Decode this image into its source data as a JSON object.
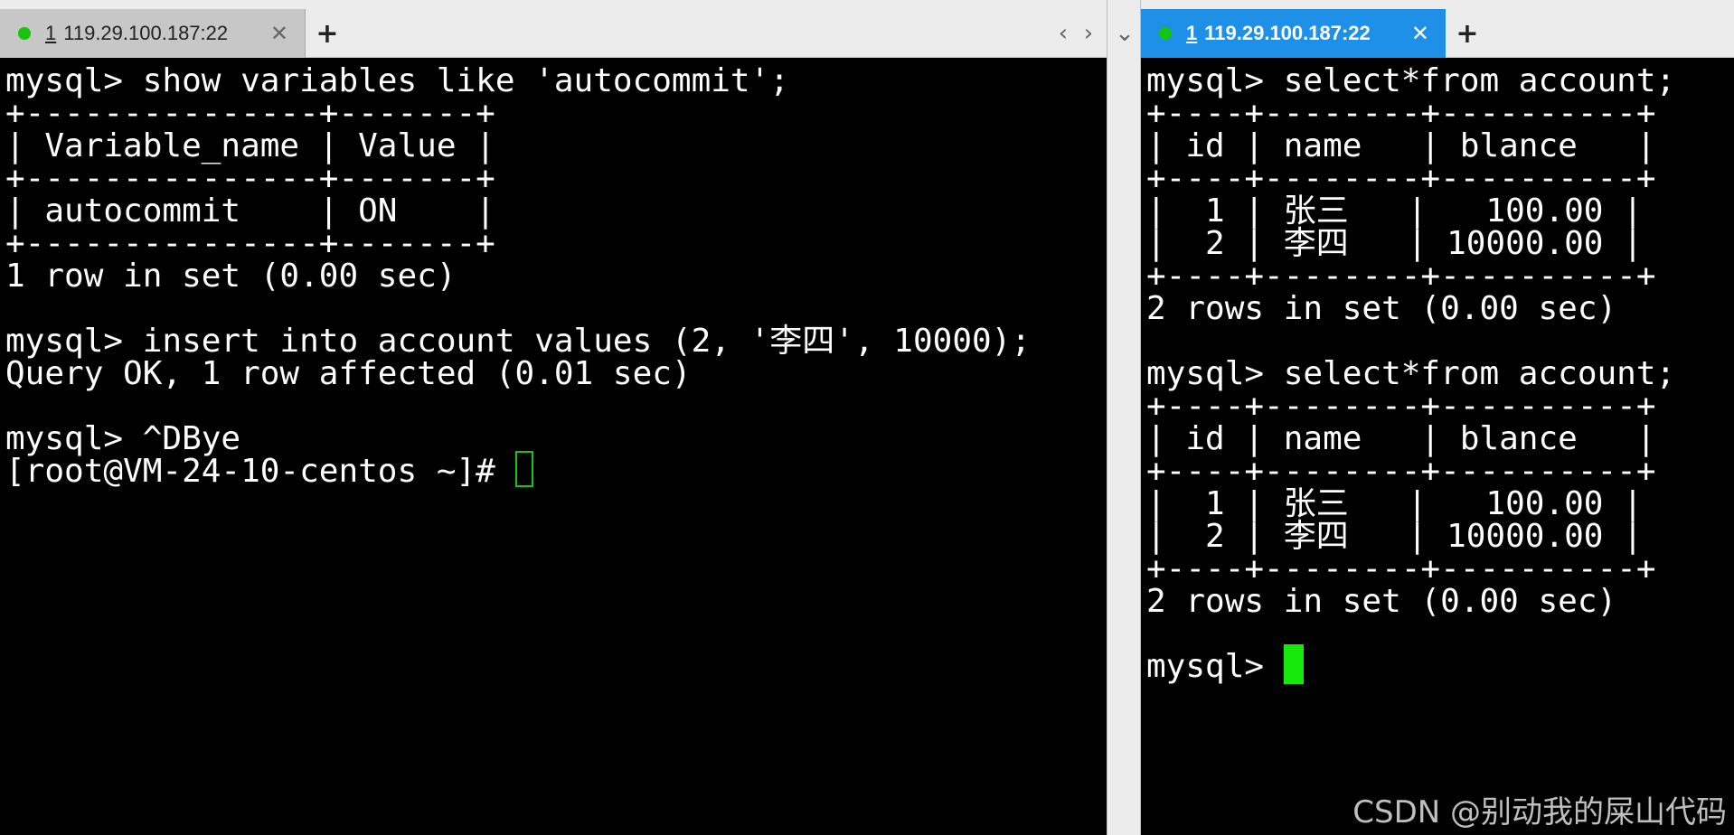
{
  "left_pane": {
    "tab": {
      "number": "1",
      "title": "119.29.100.187:22",
      "status_color": "#16c60c"
    },
    "new_tab_label": "+",
    "nav": {
      "prev_label": "‹",
      "next_label": "›",
      "menu_label": "⌄"
    },
    "terminal_lines": [
      "mysql> show variables like 'autocommit';",
      "+---------------+-------+",
      "| Variable_name | Value |",
      "+---------------+-------+",
      "| autocommit    | ON    |",
      "+---------------+-------+",
      "1 row in set (0.00 sec)",
      "",
      "mysql> insert into account values (2, '李四', 10000);",
      "Query OK, 1 row affected (0.01 sec)",
      "",
      "mysql> ^DBye",
      "[root@VM-24-10-centos ~]# "
    ]
  },
  "right_pane": {
    "tab": {
      "number": "1",
      "title": "119.29.100.187:22",
      "active_color": "#1e90e8",
      "status_color": "#16c60c"
    },
    "new_tab_label": "+",
    "terminal_lines": [
      "mysql> select*from account;",
      "+----+--------+----------+",
      "| id | name   | blance   |",
      "+----+--------+----------+",
      "|  1 | 张三   |   100.00 |",
      "|  2 | 李四   | 10000.00 |",
      "+----+--------+----------+",
      "2 rows in set (0.00 sec)",
      "",
      "mysql> select*from account;",
      "+----+--------+----------+",
      "| id | name   | blance   |",
      "+----+--------+----------+",
      "|  1 | 张三   |   100.00 |",
      "|  2 | 李四   | 10000.00 |",
      "+----+--------+----------+",
      "2 rows in set (0.00 sec)",
      "",
      "mysql> "
    ]
  },
  "watermark": "CSDN @别动我的屎山代码"
}
